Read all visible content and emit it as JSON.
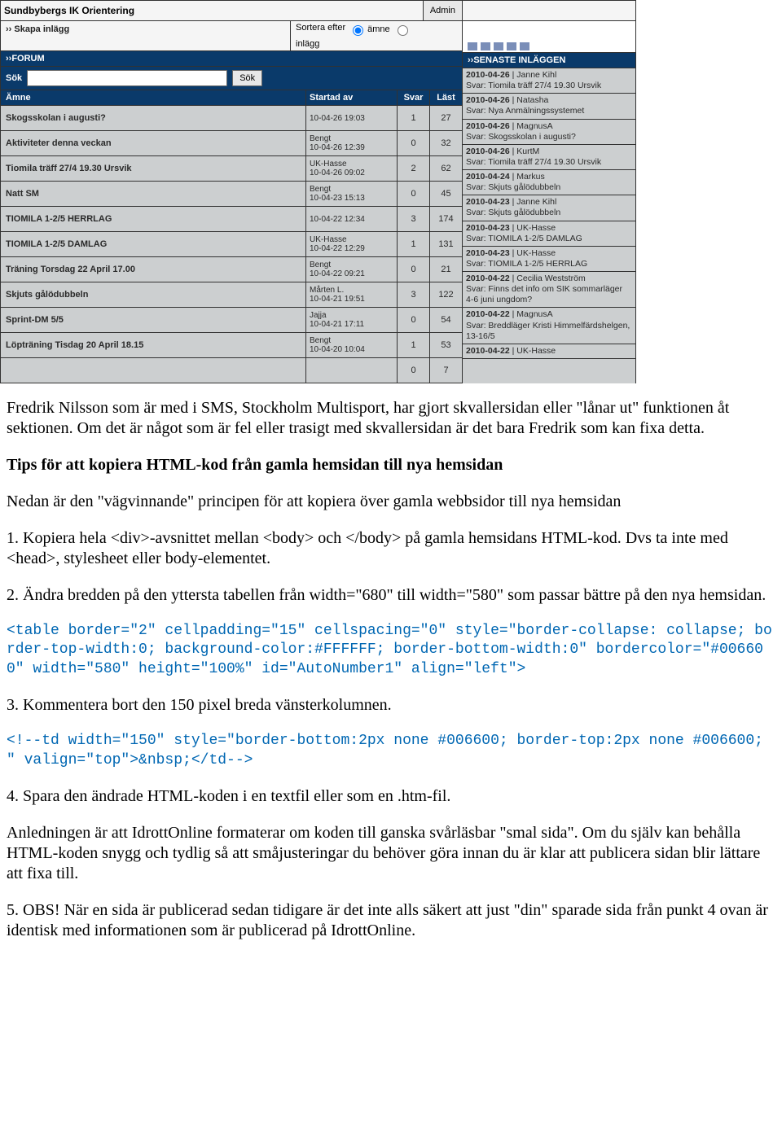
{
  "forum": {
    "site_title": "Sundbybergs IK Orientering",
    "admin_label": "Admin",
    "create_post": "›› Skapa inlägg",
    "sort_label": "Sortera efter",
    "sort_opt1": "ämne",
    "sort_opt2": "inlägg",
    "forum_label": "››FORUM",
    "search_label": "Sök",
    "search_button": "Sök",
    "col_topic": "Ämne",
    "col_start": "Startad av",
    "col_svar": "Svar",
    "col_last": "Läst",
    "rows": [
      {
        "topic": "Skogsskolan i augusti?",
        "who": "",
        "date": "10-04-26 19:03",
        "svar": "1",
        "last": "27"
      },
      {
        "topic": "Aktiviteter denna veckan",
        "who": "Bengt",
        "date": "10-04-26 12:39",
        "svar": "0",
        "last": "32"
      },
      {
        "topic": "Tiomila träff 27/4 19.30 Ursvik",
        "who": "UK-Hasse",
        "date": "10-04-26 09:02",
        "svar": "2",
        "last": "62"
      },
      {
        "topic": "Natt SM",
        "who": "Bengt",
        "date": "10-04-23 15:13",
        "svar": "0",
        "last": "45"
      },
      {
        "topic": "TIOMILA 1-2/5 HERRLAG",
        "who": "",
        "date": "10-04-22 12:34",
        "svar": "3",
        "last": "174"
      },
      {
        "topic": "TIOMILA 1-2/5 DAMLAG",
        "who": "UK-Hasse",
        "date": "10-04-22 12:29",
        "svar": "1",
        "last": "131"
      },
      {
        "topic": "Träning Torsdag 22 April 17.00",
        "who": "Bengt",
        "date": "10-04-22 09:21",
        "svar": "0",
        "last": "21"
      },
      {
        "topic": "Skjuts gålödubbeln",
        "who": "Mårten L.",
        "date": "10-04-21 19:51",
        "svar": "3",
        "last": "122"
      },
      {
        "topic": "Sprint-DM 5/5",
        "who": "Jajja",
        "date": "10-04-21 17:11",
        "svar": "0",
        "last": "54"
      },
      {
        "topic": "Löpträning Tisdag 20 April 18.15",
        "who": "Bengt",
        "date": "10-04-20 10:04",
        "svar": "1",
        "last": "53"
      },
      {
        "topic": "",
        "who": "",
        "date": "",
        "svar": "0",
        "last": "7"
      }
    ]
  },
  "recent": {
    "title": "››SENASTE INLÄGGEN",
    "rows": [
      {
        "line1": "2010-04-26  |  Janne Kihl",
        "line2": "Svar: Tiomila träff 27/4 19.30 Ursvik"
      },
      {
        "line1": "2010-04-26  |  Natasha",
        "line2": "Svar: Nya Anmälningssystemet"
      },
      {
        "line1": "2010-04-26  |  MagnusA",
        "line2": "Svar: Skogsskolan i augusti?"
      },
      {
        "line1": "2010-04-26  |  KurtM",
        "line2": "Svar: Tiomila träff 27/4 19.30 Ursvik"
      },
      {
        "line1": "2010-04-24  |  Markus",
        "line2": "Svar: Skjuts gålödubbeln"
      },
      {
        "line1": "2010-04-23  |  Janne Kihl",
        "line2": "Svar: Skjuts gålödubbeln"
      },
      {
        "line1": "2010-04-23  |  UK-Hasse",
        "line2": "Svar: TIOMILA 1-2/5 DAMLAG"
      },
      {
        "line1": "2010-04-23  |  UK-Hasse",
        "line2": "Svar: TIOMILA 1-2/5 HERRLAG"
      },
      {
        "line1": "2010-04-22  |  Cecilia Westström",
        "line2": "Svar: Finns det info om SIK sommarläger 4-6 juni ungdom?"
      },
      {
        "line1": "2010-04-22  |  MagnusA",
        "line2": "Svar: Breddläger Kristi Himmelfärdshelgen, 13-16/5"
      },
      {
        "line1": "2010-04-22  |  UK-Hasse",
        "line2": ""
      }
    ]
  },
  "doc": {
    "p1": "Fredrik Nilsson som är med i SMS, Stockholm Multisport, har gjort skvallersidan eller \"lånar ut\" funktionen åt sektionen. Om det är något som är fel eller trasigt med skvallersidan är det bara Fredrik som kan fixa detta.",
    "h2": "Tips för att kopiera HTML-kod från gamla hemsidan till nya hemsidan",
    "p2": "Nedan är den \"vägvinnande\" principen för att kopiera över gamla webbsidor till nya hemsidan",
    "li1": "1. Kopiera hela <div>-avsnittet mellan <body> och </body> på gamla hemsidans HTML-kod. Dvs ta inte med <head>, stylesheet eller body-elementet.",
    "li2": "2. Ändra bredden på den yttersta tabellen från width=\"680\" till width=\"580\" som passar bättre på den nya hemsidan.",
    "code1": "<table border=\"2\" cellpadding=\"15\" cellspacing=\"0\" style=\"border-collapse: collapse; border-top-width:0; background-color:#FFFFFF; border-bottom-width:0\" bordercolor=\"#006600\" width=\"580\" height=\"100%\" id=\"AutoNumber1\" align=\"left\">",
    "li3": "3. Kommentera bort den 150 pixel breda vänsterkolumnen.",
    "code2": "<!--td width=\"150\" style=\"border-bottom:2px none #006600; border-top:2px none #006600; \" valign=\"top\">&nbsp;</td-->",
    "li4": "4. Spara den ändrade HTML-koden i en textfil eller som en .htm-fil.",
    "p3": "Anledningen är att IdrottOnline formaterar om koden till ganska svårläsbar \"smal sida\". Om du själv kan behålla HTML-koden snygg och tydlig så att småjusteringar du behöver göra innan du är klar att publicera sidan blir lättare att fixa till.",
    "li5": "5. OBS! När en sida är publicerad sedan tidigare är det inte alls säkert att just \"din\" sparade sida från punkt 4 ovan är identisk med informationen som är publicerad på IdrottOnline."
  }
}
